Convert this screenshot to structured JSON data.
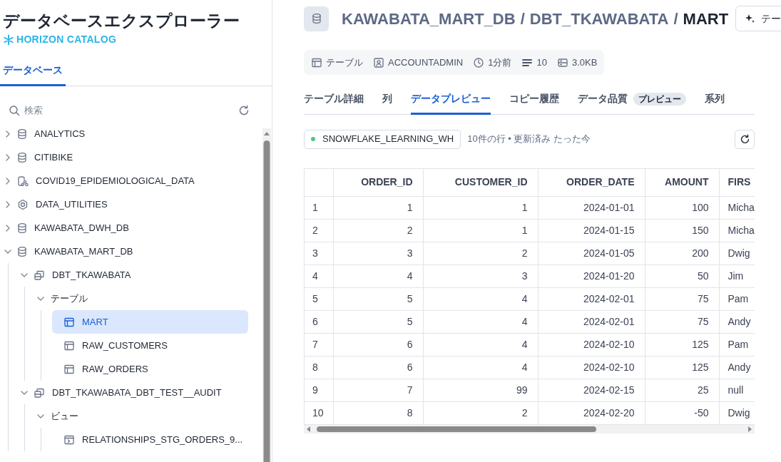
{
  "sidebar": {
    "title": "データベースエクスプローラー",
    "brand": "HORIZON CATALOG",
    "tabs": [
      {
        "label": "データベース",
        "selected": true
      }
    ],
    "search": {
      "placeholder": "検索"
    },
    "tree": [
      {
        "label": "ANALYTICS",
        "kind": "database",
        "expanded": false,
        "selected": false
      },
      {
        "label": "CITIBIKE",
        "kind": "database",
        "expanded": false,
        "selected": false
      },
      {
        "label": "COVID19_EPIDEMIOLOGICAL_DATA",
        "kind": "shared",
        "expanded": false,
        "selected": false
      },
      {
        "label": "DATA_UTILITIES",
        "kind": "app",
        "expanded": false,
        "selected": false
      },
      {
        "label": "KAWABATA_DWH_DB",
        "kind": "database",
        "expanded": false,
        "selected": false
      },
      {
        "label": "KAWABATA_MART_DB",
        "kind": "database",
        "expanded": true,
        "selected": false,
        "children": [
          {
            "label": "DBT_TKAWABATA",
            "kind": "schema",
            "expanded": true,
            "selected": false,
            "children": [
              {
                "label": "テーブル",
                "expanded": true,
                "selected": false,
                "children": [
                  {
                    "label": "MART",
                    "kind": "table",
                    "selected": true
                  },
                  {
                    "label": "RAW_CUSTOMERS",
                    "kind": "table",
                    "selected": false
                  },
                  {
                    "label": "RAW_ORDERS",
                    "kind": "table",
                    "selected": false
                  }
                ]
              }
            ]
          },
          {
            "label": "DBT_TKAWABATA_DBT_TEST__AUDIT",
            "kind": "schema",
            "expanded": true,
            "selected": false,
            "children": [
              {
                "label": "ビュー",
                "expanded": true,
                "selected": false,
                "children": [
                  {
                    "label": "RELATIONSHIPS_STG_ORDERS_9...",
                    "kind": "view",
                    "selected": false
                  }
                ]
              }
            ]
          }
        ]
      }
    ]
  },
  "header": {
    "breadcrumb": [
      {
        "label": "KAWABATA_MART_DB",
        "current": false
      },
      {
        "label": "DBT_TKAWABATA",
        "current": false
      },
      {
        "label": "MART",
        "current": true
      }
    ],
    "separator": "/",
    "action_button": "テー"
  },
  "meta": [
    {
      "kind": "type",
      "text": "テーブル"
    },
    {
      "kind": "owner",
      "text": "ACCOUNTADMIN"
    },
    {
      "kind": "time",
      "text": "1分前"
    },
    {
      "kind": "rows",
      "text": "10"
    },
    {
      "kind": "size",
      "text": "3.0KB"
    }
  ],
  "tabs": [
    {
      "label": "テーブル詳細",
      "selected": false
    },
    {
      "label": "列",
      "selected": false
    },
    {
      "label": "データプレビュー",
      "selected": true
    },
    {
      "label": "コピー履歴",
      "selected": false
    },
    {
      "label": "データ品質",
      "badge": "プレビュー",
      "selected": false
    },
    {
      "label": "系列",
      "selected": false
    }
  ],
  "warehouse": {
    "name": "SNOWFLAKE_LEARNING_WH",
    "color": "#4cc38a"
  },
  "status": "10件の行 • 更新済み たった今",
  "table": {
    "columns": [
      "",
      "ORDER_ID",
      "CUSTOMER_ID",
      "ORDER_DATE",
      "AMOUNT",
      "FIRS"
    ],
    "rows": [
      [
        "1",
        "1",
        "1",
        "2024-01-01",
        "100",
        "Micha"
      ],
      [
        "2",
        "2",
        "1",
        "2024-01-15",
        "150",
        "Micha"
      ],
      [
        "3",
        "3",
        "2",
        "2024-01-05",
        "200",
        "Dwig"
      ],
      [
        "4",
        "4",
        "3",
        "2024-01-20",
        "50",
        "Jim"
      ],
      [
        "5",
        "5",
        "4",
        "2024-02-01",
        "75",
        "Pam"
      ],
      [
        "6",
        "5",
        "4",
        "2024-02-01",
        "75",
        "Andy"
      ],
      [
        "7",
        "6",
        "4",
        "2024-02-10",
        "125",
        "Pam"
      ],
      [
        "8",
        "6",
        "4",
        "2024-02-10",
        "125",
        "Andy"
      ],
      [
        "9",
        "7",
        "99",
        "2024-02-15",
        "25",
        "null"
      ],
      [
        "10",
        "8",
        "2",
        "2024-02-20",
        "-50",
        "Dwig"
      ]
    ]
  }
}
